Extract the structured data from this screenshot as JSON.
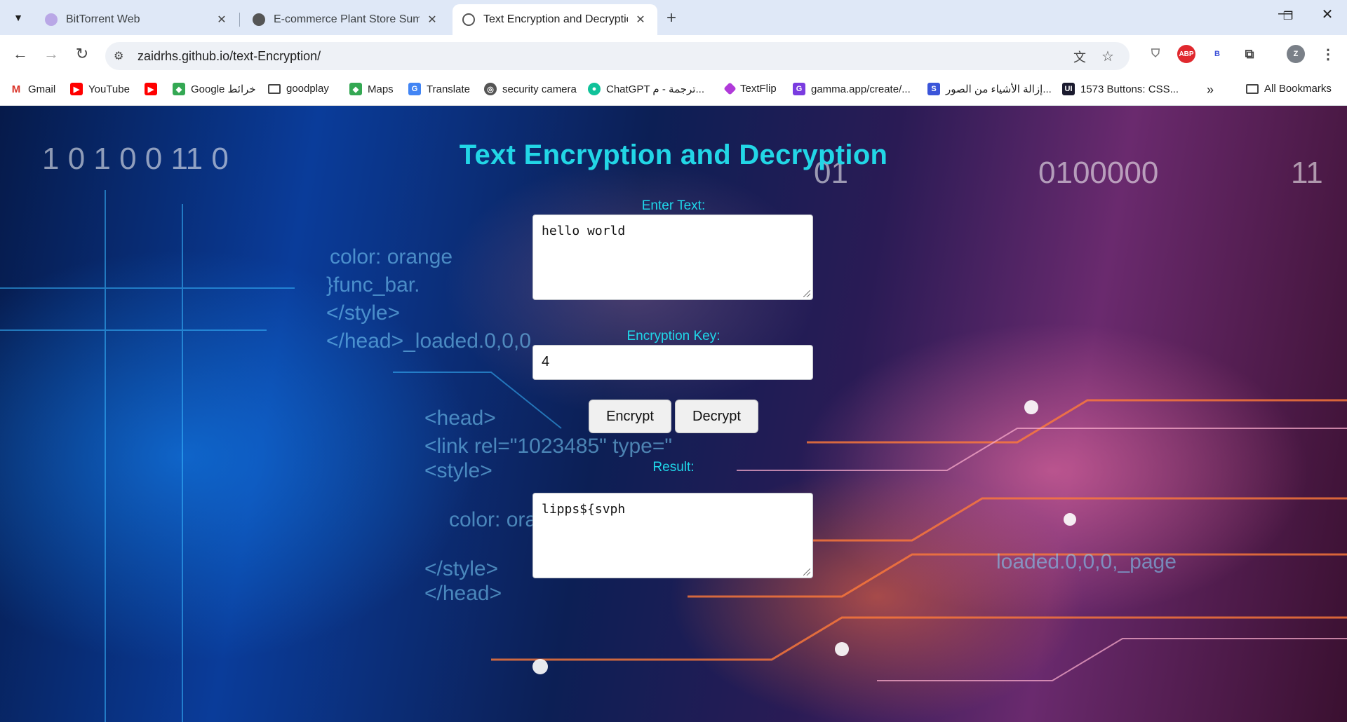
{
  "tabs": [
    {
      "title": "BitTorrent Web"
    },
    {
      "title": "E-commerce Plant Store Summ"
    },
    {
      "title": "Text Encryption and Decryption"
    }
  ],
  "address_bar": {
    "url": "zaidrhs.github.io/text-Encryption/"
  },
  "extensions": {
    "abp": "ABP",
    "b": "B",
    "profile": "Z"
  },
  "bookmarks": [
    {
      "label": "Gmail"
    },
    {
      "label": "YouTube"
    },
    {
      "label": "Google خرائط"
    },
    {
      "label": "goodplay"
    },
    {
      "label": "Maps"
    },
    {
      "label": "Translate"
    },
    {
      "label": "security camera"
    },
    {
      "label": "ChatGPT ترجمة - م..."
    },
    {
      "label": "TextFlip"
    },
    {
      "label": "gamma.app/create/..."
    },
    {
      "label": "إزالة الأشياء من الصور..."
    },
    {
      "label": "1573 Buttons: CSS..."
    }
  ],
  "all_bookmarks_label": "All Bookmarks",
  "app": {
    "title": "Text Encryption and Decryption",
    "enter_text_label": "Enter Text:",
    "input_text": "hello world",
    "key_label": "Encryption Key:",
    "key_value": "4",
    "encrypt_label": "Encrypt",
    "decrypt_label": "Decrypt",
    "result_label": "Result:",
    "result_text": "lipps${svph"
  },
  "colors": {
    "accent": "#22d6e6"
  }
}
